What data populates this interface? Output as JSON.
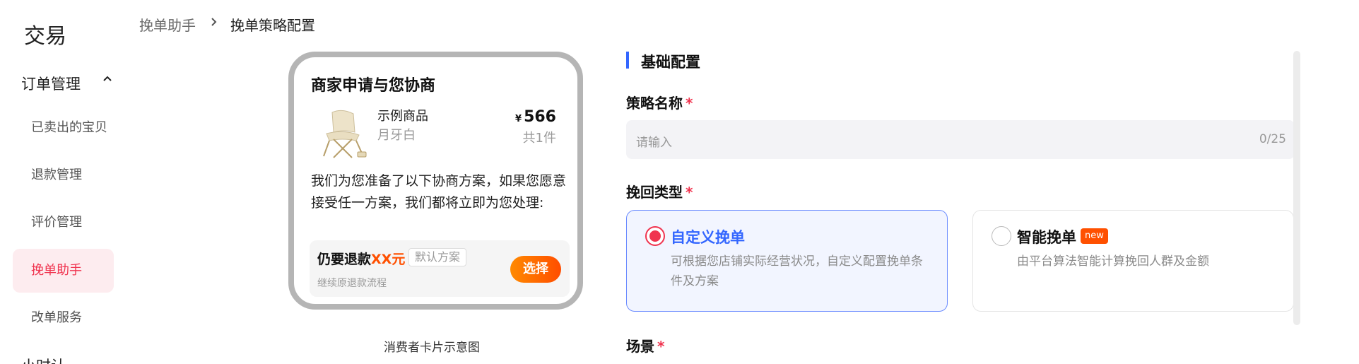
{
  "sidebar": {
    "brand": "交易",
    "group_title": "订单管理",
    "items": [
      {
        "label": "已卖出的宝贝"
      },
      {
        "label": "退款管理"
      },
      {
        "label": "评价管理"
      },
      {
        "label": "挽单助手"
      },
      {
        "label": "改单服务"
      }
    ],
    "active_item": "挽单助手",
    "next_group_partial": "小时认"
  },
  "breadcrumb": {
    "parent": "挽单助手",
    "current": "挽单策略配置"
  },
  "preview_card": {
    "title": "商家申请与您协商",
    "product": {
      "image_icon": "folding-chair-image",
      "name": "示例商品",
      "variant": "月牙白",
      "currency": "¥",
      "price": "566",
      "quantity": "共1件"
    },
    "description": "我们为您准备了以下协商方案，如果您愿意接受任一方案，我们都将立即为您处理:",
    "offer": {
      "main_prefix": "仍要退款",
      "main_highlight": "XX元",
      "tag": "默认方案",
      "sub": "继续原退款流程",
      "button": "选择"
    },
    "caption": "消费者卡片示意图"
  },
  "form": {
    "section_title": "基础配置",
    "strategy_name": {
      "label": "策略名称",
      "required_mark": "*",
      "placeholder": "请输入",
      "counter": "0/25"
    },
    "recovery_type": {
      "label": "挽回类型",
      "required_mark": "*",
      "options": [
        {
          "title": "自定义挽单",
          "desc": "可根据您店铺实际经营状况，自定义配置挽单条件及方案",
          "selected": true
        },
        {
          "title": "智能挽单",
          "badge": "new",
          "desc": "由平台算法智能计算挽回人群及金额",
          "selected": false
        }
      ]
    },
    "scene": {
      "label": "场景",
      "required_mark": "*"
    }
  },
  "colors": {
    "accent_red": "#f0344f",
    "accent_blue": "#3366ff",
    "orange": "#ff5000"
  }
}
